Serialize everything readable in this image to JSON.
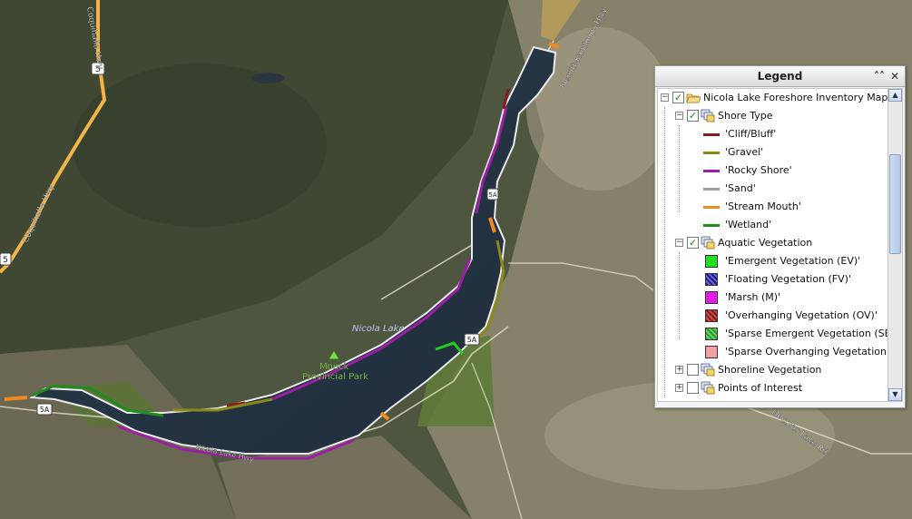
{
  "map": {
    "lake_label": "Nicola Lake",
    "park_label_line1": "Monck",
    "park_label_line2": "Provincial Park",
    "hwy_shield_5_top": "5",
    "hwy_shield_5_left": "5",
    "hwy_shield_5a_right": "5A",
    "hwy_shield_5a_left": "5A",
    "hwy_shield_5a_shore": "5A",
    "road_coquihalla_top": "Coquihalla Hwy",
    "road_coquihalla_left": "Coquihalla Hwy",
    "road_merritt_kamloops": "Merritt-Kamloops Hwy",
    "road_douglas_lake": "Douglas Lake Rd",
    "road_south_shore": "Nicola Lake Hwy"
  },
  "legend": {
    "title": "Legend",
    "collapse_icon": "double-chevron-up-icon",
    "close_icon": "close-icon",
    "root_layer": "Nicola Lake Foreshore Inventory Mapping",
    "groups": [
      {
        "name": "Shore Type",
        "checked": true,
        "expanded": true,
        "items": [
          {
            "label": "'Cliff/Bluff'",
            "color": "#8b1a1a"
          },
          {
            "label": "'Gravel'",
            "color": "#8a8a1a"
          },
          {
            "label": "'Rocky Shore'",
            "color": "#9b1fa3"
          },
          {
            "label": "'Sand'",
            "color": "#a0a0a0"
          },
          {
            "label": "'Stream Mouth'",
            "color": "#f08a1e"
          },
          {
            "label": "'Wetland'",
            "color": "#1f8c1f"
          }
        ]
      },
      {
        "name": "Aquatic Vegetation",
        "checked": true,
        "expanded": true,
        "items": [
          {
            "label": "'Emergent Vegetation (EV)'",
            "color": "#22dd22"
          },
          {
            "label": "'Floating Vegetation (FV)'",
            "color": "#1a1a8a"
          },
          {
            "label": "'Marsh (M)'",
            "color": "#e020e0"
          },
          {
            "label": "'Overhanging Vegetation (OV)'",
            "color": "#8a1a1a"
          },
          {
            "label": "'Sparse Emergent Vegetation (SEV)'",
            "color": "#2a9a2a"
          },
          {
            "label": "'Sparse Overhanging Vegetation (SOV)'",
            "color": "#f0a0a0"
          }
        ]
      },
      {
        "name": "Shoreline Vegetation",
        "checked": false,
        "expanded": false,
        "items": []
      },
      {
        "name": "Points of Interest",
        "checked": false,
        "expanded": false,
        "items": []
      }
    ]
  }
}
